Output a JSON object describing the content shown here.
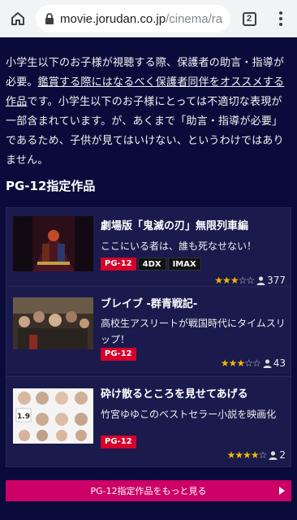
{
  "browser": {
    "url_host": "movie.jorudan.co.jp",
    "url_path": "/cinema/ratin",
    "tab_count": "2"
  },
  "intro": {
    "text_before_link": "小学生以下のお子様が視聴する際、保護者の助言・指導が必要。",
    "link_text": "鑑賞する際にはなるべく保護者同伴をオススメする作品",
    "text_after_link": "です。小学生以下のお子様にとっては不適切な表現が一部含まれています。が、あくまで「助言・指導が必要」であるため、子供が見てはいけない、というわけではありません。"
  },
  "section": {
    "title": "PG-12指定作品"
  },
  "movies": [
    {
      "title": "劇場版「鬼滅の刃」無限列車編",
      "description": "ここにいる者は、誰も死なせない！",
      "tags": [
        "PG-12",
        "4DX",
        "IMAX"
      ],
      "rating": 3,
      "count": "377"
    },
    {
      "title": "ブレイブ -群青戦記-",
      "description": "高校生アスリートが戦国時代にタイムスリップ！",
      "tags": [
        "PG-12"
      ],
      "rating": 3,
      "count": "43"
    },
    {
      "title": "砕け散るところを見せてあげる",
      "description": "竹宮ゆゆこのベストセラー小説を映画化",
      "tags": [
        "PG-12"
      ],
      "rating": 4,
      "count": "2"
    }
  ],
  "more_button": {
    "label": "PG-12指定作品をもっと見る"
  },
  "colors": {
    "background": "#0b0b3b",
    "card": "#1a1a4d",
    "rating_tag": "#d6002a",
    "accent_button": "#cc0066",
    "star": "#f2b800"
  }
}
